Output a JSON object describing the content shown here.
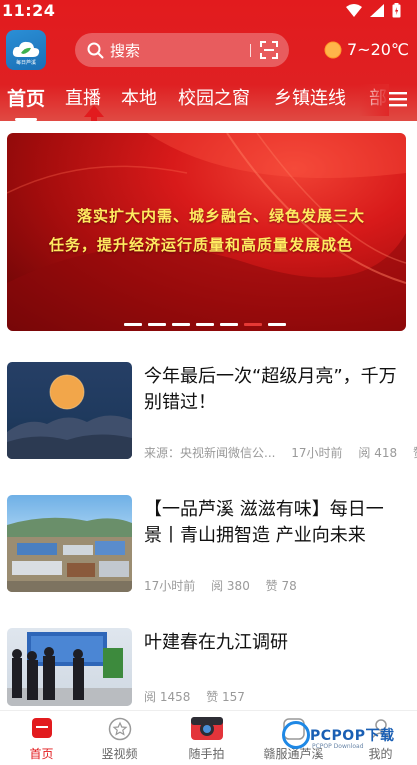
{
  "status_bar": {
    "time": "11:24"
  },
  "header": {
    "logo_text": "每日芦溪",
    "search_placeholder": "搜索",
    "weather_temp": "7~20℃"
  },
  "tabs": [
    "首页",
    "直播",
    "本地",
    "校园之窗",
    "乡镇连线",
    "部"
  ],
  "banner": {
    "line1": "落实扩大内需、城乡融合、绿色发展三大",
    "line2": "任务，提升经济运行质量和高质量发展成色",
    "dot_count": 7,
    "active_dot": 6
  },
  "news": [
    {
      "title": "今年最后一次“超级月亮”，千万别错过！",
      "source": "来源：央视新闻微信公...",
      "time": "17小时前",
      "reads": "阅 418",
      "likes": "赞"
    },
    {
      "title": "【一品芦溪 滋滋有味】每日一景丨青山拥智造 产业向未来",
      "time": "17小时前",
      "reads": "阅 380",
      "likes": "赞 78"
    },
    {
      "title": "叶建春在九江调研",
      "reads": "阅 1458",
      "likes": "赞 157"
    }
  ],
  "bottom_nav": [
    {
      "label": "首页",
      "icon": "home-icon",
      "active": true
    },
    {
      "label": "竖视频",
      "icon": "star-icon",
      "active": false
    },
    {
      "label": "随手拍",
      "icon": "camera-icon",
      "active": false
    },
    {
      "label": "赣服通芦溪",
      "icon": "service-icon",
      "active": false
    },
    {
      "label": "我的",
      "icon": "user-icon",
      "active": false
    }
  ],
  "watermark": {
    "text": "PCPOP下载",
    "sub": "PCPOP Download"
  },
  "colors": {
    "brand_red": "#e21b1e",
    "banner_text": "#ffeb60",
    "meta_gray": "#9a9a9a"
  }
}
